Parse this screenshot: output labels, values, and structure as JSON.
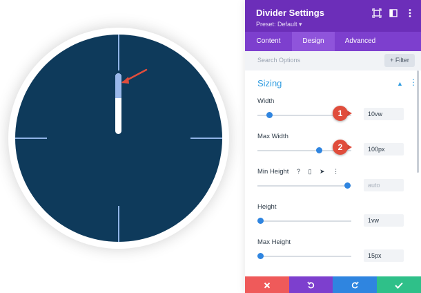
{
  "panel": {
    "title": "Divider Settings",
    "preset": "Preset: Default ▾",
    "colors": {
      "header": "#6c2eb9",
      "tab_bar": "#7d3fce",
      "active_tab": "#8f54db",
      "accent_blue": "#2f9ce0"
    },
    "header_icons": [
      "expand-icon",
      "columns-icon",
      "more-vertical-icon"
    ]
  },
  "tabs": [
    {
      "label": "Content",
      "active": false
    },
    {
      "label": "Design",
      "active": true
    },
    {
      "label": "Advanced",
      "active": false
    }
  ],
  "search": {
    "placeholder": "Search Options",
    "filter_label": "+ Filter"
  },
  "section": {
    "title": "Sizing",
    "fields": [
      {
        "label": "Width",
        "value": "10vw",
        "slider_fraction": 0.13
      },
      {
        "label": "Max Width",
        "value": "100px",
        "slider_fraction": 0.65
      },
      {
        "label": "Min Height",
        "value": "auto",
        "slider_fraction": 0.96,
        "icons": [
          "help-icon",
          "phone-icon",
          "cursor-icon",
          "more-vertical-icon"
        ]
      },
      {
        "label": "Height",
        "value": "1vw",
        "slider_fraction": 0.03
      },
      {
        "label": "Max Height",
        "value": "15px",
        "slider_fraction": 0.03
      }
    ]
  },
  "callouts": [
    "1",
    "2"
  ],
  "footer": [
    {
      "name": "cancel-button",
      "icon": "close-icon",
      "color": "#ef5a5a"
    },
    {
      "name": "undo-button",
      "icon": "undo-icon",
      "color": "#7d3fce"
    },
    {
      "name": "redo-button",
      "icon": "redo-icon",
      "color": "#2f85e0"
    },
    {
      "name": "save-button",
      "icon": "check-icon",
      "color": "#2fc089"
    }
  ],
  "canvas": {
    "clock_face_color": "#0e3a5b",
    "tick_color": "#8fb3e6"
  }
}
